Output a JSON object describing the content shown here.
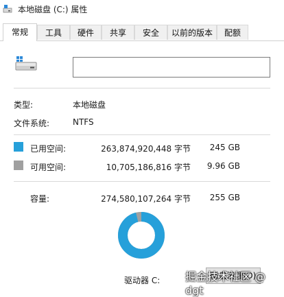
{
  "window": {
    "title": "本地磁盘 (C:) 属性"
  },
  "tabs": [
    {
      "label": "常规"
    },
    {
      "label": "工具"
    },
    {
      "label": "硬件"
    },
    {
      "label": "共享"
    },
    {
      "label": "安全"
    },
    {
      "label": "以前的版本"
    },
    {
      "label": "配额"
    }
  ],
  "general": {
    "name_value": "",
    "type_label": "类型:",
    "type_value": "本地磁盘",
    "fs_label": "文件系统:",
    "fs_value": "NTFS",
    "used": {
      "label": "已用空间:",
      "bytes": "263,874,920,448 字节",
      "size": "245 GB",
      "color": "#26a0da"
    },
    "free": {
      "label": "可用空间:",
      "bytes": "10,705,186,816 字节",
      "size": "9.96 GB",
      "color": "#a0a0a0"
    },
    "capacity": {
      "label": "容量:",
      "bytes": "274,580,107,264 字节",
      "size": "255 GB"
    },
    "used_fraction": 0.961,
    "drive_label": "驱动器 C:",
    "cleanup_button": "磁盘清理(D)"
  },
  "watermark": "掘金技术社区 @ dgt",
  "icons": {
    "app": "drive-properties-icon",
    "drive": "hard-drive-icon"
  }
}
